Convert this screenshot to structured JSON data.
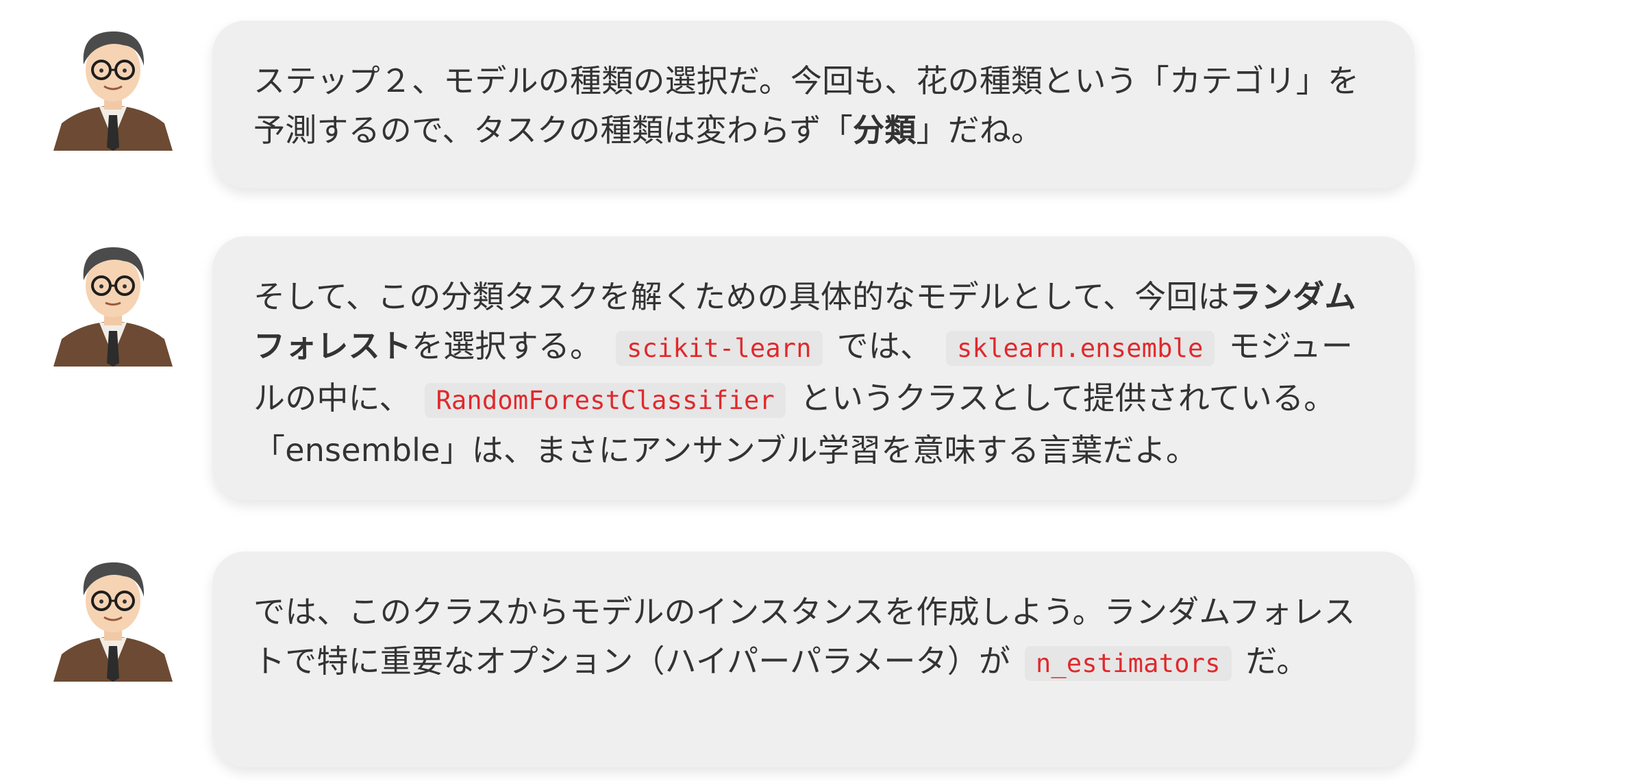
{
  "messages": [
    {
      "avatar": "teacher-avatar",
      "segments": [
        {
          "text": "ステップ２、モデルの種類の選択だ。今回も、花の種類という「カテゴリ」を予測するので、タスクの種類は変わらず「",
          "style": "normal"
        },
        {
          "text": "分類",
          "style": "bold"
        },
        {
          "text": "」だね。",
          "style": "normal"
        }
      ]
    },
    {
      "avatar": "teacher-avatar",
      "segments": [
        {
          "text": "そして、この分類タスクを解くための具体的なモデルとして、今回は",
          "style": "normal"
        },
        {
          "text": "ランダムフォレスト",
          "style": "bold"
        },
        {
          "text": "を選択する。",
          "style": "normal"
        },
        {
          "text": "scikit-learn",
          "style": "code"
        },
        {
          "text": "では、",
          "style": "normal"
        },
        {
          "text": "sklearn.ensemble",
          "style": "code"
        },
        {
          "text": "モジュールの中に、",
          "style": "normal"
        },
        {
          "text": "RandomForestClassifier",
          "style": "code"
        },
        {
          "text": "というクラスとして提供されている。「ensemble」は、まさにアンサンブル学習を意味する言葉だよ。",
          "style": "normal"
        }
      ]
    },
    {
      "avatar": "teacher-avatar",
      "segments": [
        {
          "text": "では、このクラスからモデルのインスタンスを作成しよう。ランダムフォレストで特に重要なオプション（ハイパーパラメータ）が",
          "style": "normal"
        },
        {
          "text": "n_estimators",
          "style": "code"
        },
        {
          "text": "だ。",
          "style": "normal"
        }
      ]
    }
  ],
  "colors": {
    "bubble_bg": "#efefef",
    "code_text": "#e0292c",
    "code_bg": "#e6e6e6",
    "body_text": "#333333"
  }
}
